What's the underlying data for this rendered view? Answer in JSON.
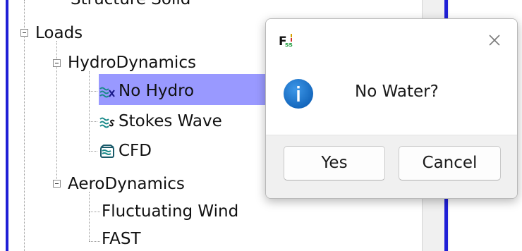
{
  "tree": {
    "partial_item": "Structure Solid",
    "items": [
      {
        "label": "Loads",
        "expanded": true
      },
      {
        "label": "HydroDynamics",
        "expanded": true
      },
      {
        "label": "No Hydro",
        "selected": true,
        "icon": "no-hydro-icon"
      },
      {
        "label": "Stokes Wave",
        "icon": "stokes-wave-icon"
      },
      {
        "label": "CFD",
        "icon": "cfd-icon"
      },
      {
        "label": "AeroDynamics",
        "expanded": true
      },
      {
        "label": "Fluctuating Wind"
      },
      {
        "label": "FAST"
      }
    ]
  },
  "dialog": {
    "app_icon": "fss-logo-icon",
    "message": "No Water?",
    "message_icon": "info-icon",
    "buttons": {
      "yes": "Yes",
      "cancel": "Cancel"
    },
    "close_icon": "close-icon"
  },
  "colors": {
    "selection": "#9999ff",
    "accent_blue": "#1f1fd6",
    "info_blue": "#1570c9"
  }
}
